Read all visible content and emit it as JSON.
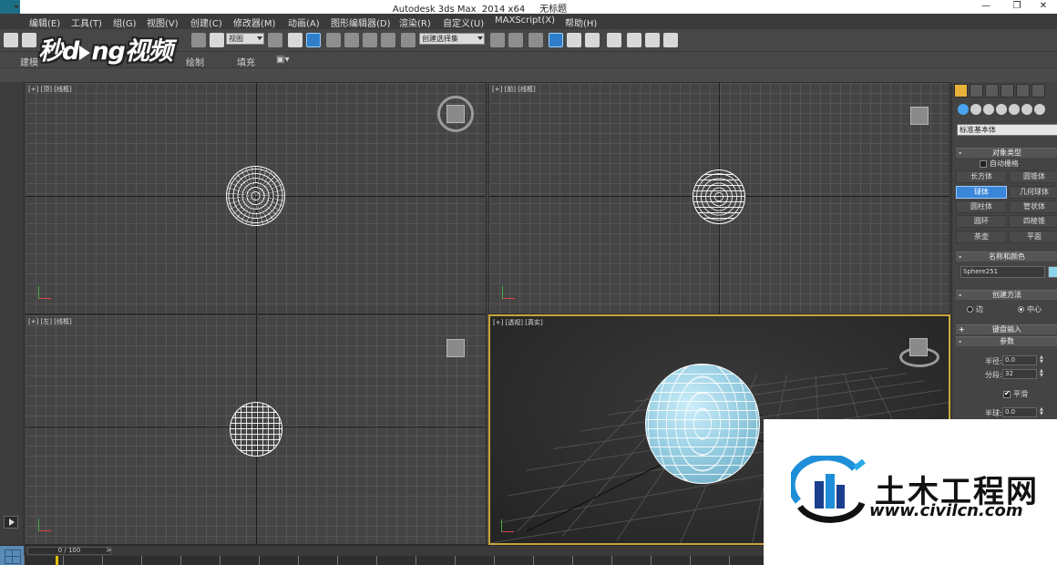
{
  "window": {
    "title": "Autodesk 3ds Max  2014 x64     无标题",
    "minimize": "—",
    "restore": "❐",
    "close": "✕"
  },
  "menu": [
    "编辑(E)",
    "工具(T)",
    "组(G)",
    "视图(V)",
    "创建(C)",
    "修改器(M)",
    "动画(A)",
    "图形编辑器(D)",
    "渲染(R)",
    "自定义(U)",
    "MAXScript(X)",
    "帮助(H)"
  ],
  "toolbar": {
    "view_select": "视图",
    "selection_set": "创建选择集"
  },
  "ribbon": {
    "tabs": [
      "建模",
      "绘制",
      "填充"
    ]
  },
  "watermark_top": {
    "part1": "秒d",
    "part2": "ng视频"
  },
  "viewports": {
    "top": {
      "label": "[+] [顶] [线框]"
    },
    "front": {
      "label": "[+] [前] [线框]"
    },
    "left": {
      "label": "[+] [左] [线框]"
    },
    "perspective": {
      "label": "[+] [透视] [真实]"
    }
  },
  "command_panel": {
    "category": "标准基本体",
    "object_type": {
      "title": "对象类型",
      "autogrid": "自动栅格",
      "buttons": [
        "长方体",
        "圆锥体",
        "球体",
        "几何球体",
        "圆柱体",
        "管状体",
        "圆环",
        "四棱锥",
        "茶壶",
        "平面"
      ],
      "active": "球体"
    },
    "name_color": {
      "title": "名称和颜色",
      "name": "Sphere251",
      "color": "#8dd3ea"
    },
    "creation_method": {
      "title": "创建方法",
      "edge": "边",
      "center": "中心"
    },
    "keyboard_entry": "键盘输入",
    "parameters": {
      "title": "参数",
      "radius_label": "半径:",
      "radius": "0.0",
      "segments_label": "分段:",
      "segments": "32",
      "smooth": "平滑",
      "hemisphere_label": "半球:",
      "hemisphere": "0.0"
    }
  },
  "timeline": {
    "frame": "0 / 100",
    "prev": "<",
    "next": ">"
  },
  "watermark_corner": {
    "cn": "土木工程网",
    "url": "www.civilcn.com"
  },
  "colors": {
    "accent_blue": "#3a86d8",
    "active_viewport_border": "#c9a43a",
    "sphere_fill": "#9fd3e6"
  }
}
